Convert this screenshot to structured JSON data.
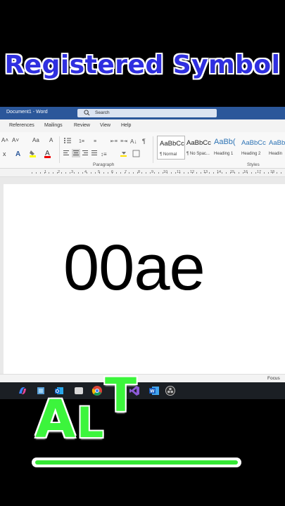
{
  "banner": {
    "title": "Registered Symbol"
  },
  "word": {
    "window_title": "Document1 - Word",
    "search_placeholder": "Search",
    "menu_tabs": [
      "References",
      "Mailings",
      "Review",
      "View",
      "Help"
    ],
    "ribbon": {
      "font_grow": "A˄",
      "font_shrink": "A˅",
      "change_case": "Aa",
      "clear_format": "A",
      "paragraph_label": "Paragraph",
      "styles_label": "Styles",
      "styles": [
        {
          "sample": "AaBbCc",
          "name": "¶ Normal"
        },
        {
          "sample": "AaBbCc",
          "name": "¶ No Spac..."
        },
        {
          "sample": "AaBb(",
          "name": "Heading 1"
        },
        {
          "sample": "AaBbCc",
          "name": "Heading 2"
        },
        {
          "sample": "AaBb",
          "name": "Headin"
        }
      ]
    },
    "ruler_numbers": [
      "1",
      "2",
      "3",
      "4",
      "5",
      "6",
      "7",
      "8",
      "9",
      "10",
      "11",
      "12",
      "13",
      "14",
      "15",
      "16",
      "17",
      "18"
    ],
    "document_text": "00ae",
    "status_focus": "Focus"
  },
  "taskbar": {
    "icons": [
      "copilot-icon",
      "files-icon",
      "outlook-icon",
      "search-app-icon",
      "chrome-icon",
      "visual-studio-icon",
      "word-icon",
      "obs-icon"
    ]
  },
  "overlay": {
    "letters": [
      "A",
      "L",
      "T"
    ],
    "accent_color": "#3cf53c",
    "title_color": "#2f2fe0"
  }
}
